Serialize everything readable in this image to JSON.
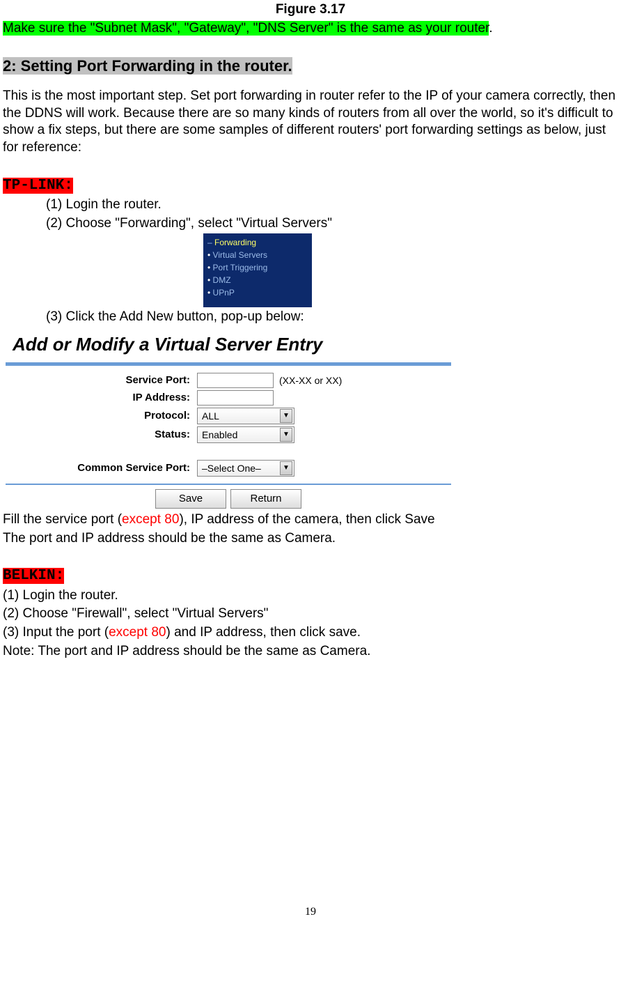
{
  "figure_caption": "Figure 3.17",
  "highlight_intro": "Make sure the \"Subnet Mask\", \"Gateway\", \"DNS Server\" is the same as your router",
  "section_title": "2: Setting Port Forwarding in the router.",
  "intro_paragraph": "This is the most important step. Set port forwarding in router refer to the IP of your camera correctly, then the DDNS will work. Because there are so many kinds of routers from all over the world, so it's difficult to show a fix steps, but there are some samples of different routers' port forwarding settings as below, just for reference:",
  "tplink": {
    "label": "TP-LINK:",
    "step1": "(1)  Login the router.",
    "step2": "(2)  Choose \"Forwarding\", select \"Virtual Servers\"",
    "step3": "(3)  Click the Add New button, pop-up below:"
  },
  "nav_menu": {
    "item0": "Forwarding",
    "item1": "Virtual Servers",
    "item2": "Port Triggering",
    "item3": "DMZ",
    "item4": "UPnP"
  },
  "vs_form": {
    "title": "Add or Modify a Virtual Server Entry",
    "labels": {
      "service_port": "Service Port:",
      "ip_address": "IP Address:",
      "protocol": "Protocol:",
      "status": "Status:",
      "common_service_port": "Common Service Port:"
    },
    "hint_service_port": "(XX-XX or XX)",
    "protocol_value": "ALL",
    "status_value": "Enabled",
    "common_value": "–Select One–",
    "save_btn": "Save",
    "return_btn": "Return"
  },
  "fill_line_pre": "Fill the service port (",
  "fill_line_red": "except 80",
  "fill_line_post": "), IP address of the camera, then click Save",
  "port_ip_line": "The port and IP address should be the same as Camera.",
  "belkin": {
    "label": "BELKIN:",
    "step1": "(1) Login the router.",
    "step2": "(2) Choose \"Firewall\", select \"Virtual Servers\"",
    "step3_pre": "(3) Input the port (",
    "step3_red": "except 80",
    "step3_post": ") and IP address, then click save.",
    "note": "Note: The port and IP address should be the same as Camera."
  },
  "page_number": "19"
}
